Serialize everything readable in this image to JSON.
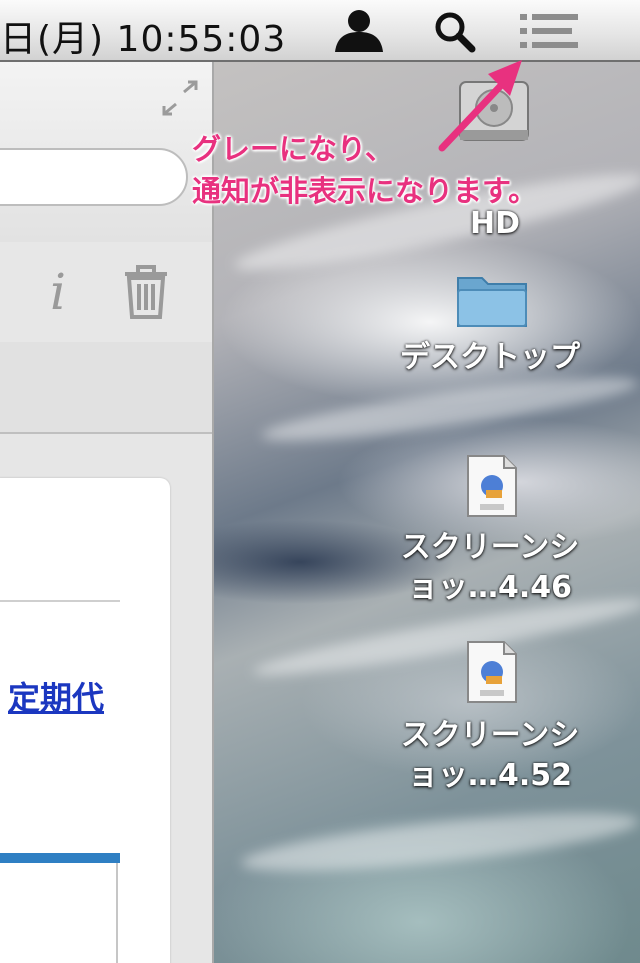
{
  "menubar": {
    "date_time": "日(月)  10:55:03",
    "icons": [
      "user-icon",
      "spotlight-search-icon",
      "notification-center-icon"
    ]
  },
  "window": {
    "content_link": "定期代"
  },
  "desktop": {
    "items": [
      {
        "icon": "hard-drive-icon",
        "label": "HD"
      },
      {
        "icon": "folder-icon",
        "label": "デスクトップ"
      },
      {
        "icon": "png-file-icon",
        "label_line1": "スクリーンシ",
        "label_line2": "ョッ…4.46"
      },
      {
        "icon": "png-file-icon",
        "label_line1": "スクリーンシ",
        "label_line2": "ョッ…4.52"
      }
    ]
  },
  "annotation": {
    "line1": "グレーになり、",
    "line2": "通知が非表示になります。",
    "color": "#e8317f"
  }
}
